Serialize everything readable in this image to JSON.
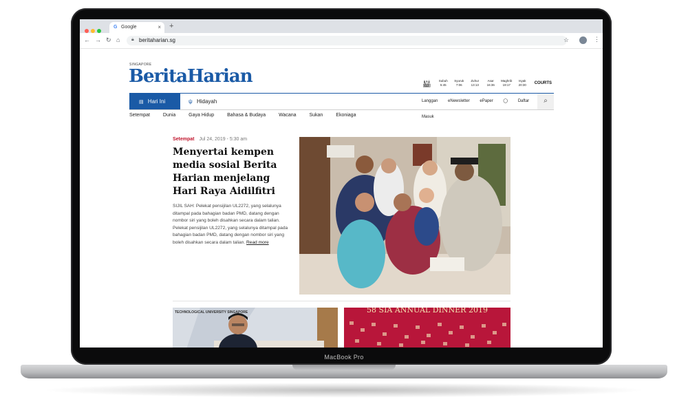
{
  "device": {
    "label": "MacBook Pro"
  },
  "browser": {
    "tab": {
      "title": "Google",
      "favicon": "G"
    },
    "url": "beritaharian.sg"
  },
  "site": {
    "region": "SINGAPORE",
    "logo": "BeritaHarian",
    "prayer_times": [
      {
        "name": "Subuh",
        "time": "5:45"
      },
      {
        "name": "Syuruk",
        "time": "7:06"
      },
      {
        "name": "Zuhur",
        "time": "13:13"
      },
      {
        "name": "Asar",
        "time": "16:36"
      },
      {
        "name": "Maghrib",
        "time": "19:17"
      },
      {
        "name": "Isyak",
        "time": "20:30"
      }
    ],
    "sponsor": "COURTS",
    "nav": {
      "tab_active": "Hari Ini",
      "tab_other": "Hidayah",
      "links": [
        "Langgan",
        "eNewsletter",
        "ePaper"
      ],
      "login": "Daftar Masuk"
    },
    "sections": [
      "Setempat",
      "Dunia",
      "Gaya Hidup",
      "Bahasa & Budaya",
      "Wacana",
      "Sukan",
      "Ekoniaga"
    ],
    "article": {
      "category": "Setempat",
      "date": "Jul 24, 2019 - 5:30 am",
      "headline": "Menyertai kempen media sosial Berita Harian menjelang Hari Raya Aidilfitri",
      "summary": "SIJIL SAH: Pelekat pensijilan UL2272, yang selalunya ditampal pada bahagian badan PMD, datang dengan nombor siri yang boleh disahkan secara dalam talian. Pelekat pensijilan UL2272, yang selalunya ditampal pada bahagian badan PMD, datang dengan nombor siri yang boleh disahkan secara dalam talian.",
      "read_more": "Read more"
    },
    "cards": [
      {
        "visible_text": "TECHNOLOGICAL UNIVERSITY SINGAPORE"
      },
      {
        "visible_text": "58 SIA ANNUAL DINNER 2019"
      }
    ]
  },
  "colors": {
    "brand_blue": "#1a5aa6",
    "category_red": "#c0142c"
  },
  "icons": [
    "mosque-icon",
    "search-icon",
    "lock-icon",
    "star-icon",
    "hidayah-icon",
    "user-icon",
    "menu-icon"
  ]
}
